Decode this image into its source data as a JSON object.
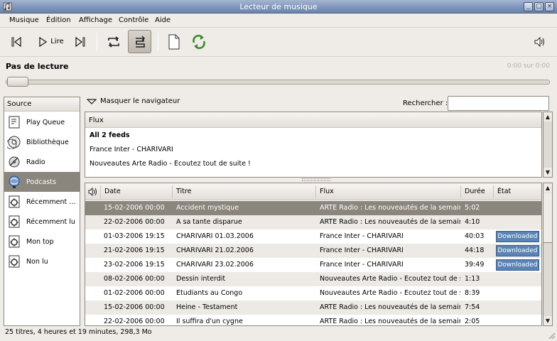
{
  "window": {
    "title": "Lecteur de musique"
  },
  "menu": [
    "Musique",
    "Édition",
    "Affichage",
    "Contrôle",
    "Aide"
  ],
  "toolbar": {
    "play_label": "Lire"
  },
  "player": {
    "status": "Pas de lecture",
    "time": "0:00 sur 0:00",
    "progress": 0
  },
  "sources": {
    "header": "Source",
    "items": [
      {
        "label": "Play Queue",
        "icon": "play-queue-icon"
      },
      {
        "label": "Bibliothèque",
        "icon": "library-icon"
      },
      {
        "label": "Radio",
        "icon": "radio-icon"
      },
      {
        "label": "Podcasts",
        "icon": "podcast-icon",
        "selected": true
      },
      {
        "label": "Récemment a...",
        "icon": "smart-playlist-icon"
      },
      {
        "label": "Récemment lu",
        "icon": "smart-playlist-icon"
      },
      {
        "label": "Mon top",
        "icon": "smart-playlist-icon"
      },
      {
        "label": "Non lu",
        "icon": "smart-playlist-icon"
      }
    ]
  },
  "browser": {
    "toggle_label": "Masquer le navigateur",
    "search_label": "Rechercher :",
    "search_value": ""
  },
  "feeds": {
    "header": "Flux",
    "items": [
      "All 2 feeds",
      "France Inter - CHARIVARI",
      "Nouveautes Arte Radio - Ecoutez tout de suite !"
    ]
  },
  "tracks": {
    "columns": {
      "date": "Date",
      "title": "Titre",
      "feed": "Flux",
      "duration": "Durée",
      "state": "État"
    },
    "rows": [
      {
        "date": "15-02-2006 00:00",
        "title": "Accident mystique",
        "feed": "ARTE Radio : Les nouveautés de la semaine",
        "duration": "5:02",
        "state": ""
      },
      {
        "date": "22-02-2006 00:00",
        "title": "A sa tante disparue",
        "feed": "ARTE Radio : Les nouveautés de la semaine",
        "duration": "4:10",
        "state": ""
      },
      {
        "date": "01-03-2006 19:15",
        "title": "CHARIVARI 01.03.2006",
        "feed": "France Inter - CHARIVARI",
        "duration": "40:03",
        "state": "Downloaded"
      },
      {
        "date": "21-02-2006 19:15",
        "title": "CHARIVARI 21.02.2006",
        "feed": "France Inter - CHARIVARI",
        "duration": "44:18",
        "state": "Downloaded"
      },
      {
        "date": "23-02-2006 19:15",
        "title": "CHARIVARI 23.02.2006",
        "feed": "France Inter - CHARIVARI",
        "duration": "39:49",
        "state": "Downloaded"
      },
      {
        "date": "08-02-2006 00:00",
        "title": "Dessin interdit",
        "feed": "Nouveautes Arte Radio - Ecoutez tout de suite",
        "duration": "1:13",
        "state": ""
      },
      {
        "date": "01-02-2006 00:00",
        "title": "Etudiants au Congo",
        "feed": "Nouveautes Arte Radio - Ecoutez tout de suite",
        "duration": "8:39",
        "state": ""
      },
      {
        "date": "15-02-2006 00:00",
        "title": "Heine - Testament",
        "feed": "ARTE Radio : Les nouveautés de la semaine",
        "duration": "7:54",
        "state": ""
      },
      {
        "date": "22-02-2006 00:00",
        "title": "Il suffira d'un cygne",
        "feed": "ARTE Radio : Les nouveautés de la semaine",
        "duration": "2:05",
        "state": ""
      }
    ]
  },
  "status": "25 titres, 4 heures et 19 minutes, 298,3 Mo"
}
